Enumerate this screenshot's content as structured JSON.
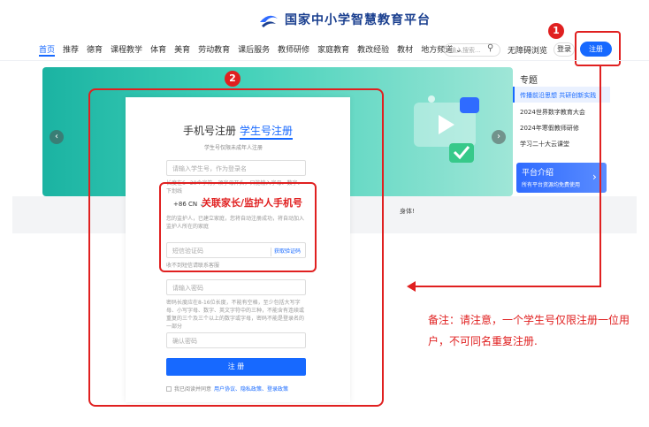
{
  "header": {
    "logo_text": "国家中小学智慧教育平台",
    "nav": [
      "首页",
      "推荐",
      "德育",
      "课程教学",
      "体育",
      "美育",
      "劳动教育",
      "课后服务",
      "教师研修",
      "家庭教育",
      "教改经验",
      "教材",
      "地方频道 ⌄"
    ],
    "search_placeholder": "输入搜索...",
    "accessibility": "无障碍浏览",
    "login": "登录",
    "register": "注册"
  },
  "badges": {
    "one": "1",
    "two": "2"
  },
  "topics": {
    "title": "专题",
    "items": [
      "传播前沿思想 共研创新实践",
      "2024世界数字教育大会",
      "2024年寒假教师研修",
      "学习二十大云课堂"
    ],
    "platform_title": "平台介绍",
    "platform_sub": "所有平台资源均免费使用",
    "platform_arrow": "›"
  },
  "banner": {
    "left_arrow": "‹",
    "right_arrow": "›",
    "band_text": "身体!"
  },
  "modal": {
    "tab_phone": "手机号注册",
    "tab_student": "学生号注册",
    "tab_hint": "学生号仅限未成年人注册",
    "student_id_placeholder": "请输入学生号，作为登录名",
    "student_id_hint": "长度在6~20个字符，须字母开头，只能输入字母、数字、下划线",
    "country_code": "+86 CN ⌄",
    "guardian_label": "关联家长/监护人手机号",
    "guardian_hint": "您的监护人，已建立家庭，您将自动注册成功，将自动加入监护人所在的家庭",
    "code_placeholder": "短信验证码",
    "code_button": "获取验证码",
    "code_help": "收不到短信请联系客服",
    "password_placeholder": "请输入密码",
    "password_hint": "密码长度应在8-16位长度，不能有空格，至少包括大写字母、小写字母、数字、英文字符中的三种，不能含有连续或重复的三个及三个以上的数字或字母，密码不能是登录名的一部分",
    "confirm_placeholder": "确认密码",
    "submit": "注 册",
    "agree_prefix": "我已阅读并同意",
    "agree_links": "用户协议、隐私政策、登录政策"
  },
  "note": "备注：请注意，一个学生号仅限注册一位用户，不可同名重复注册.",
  "colors": {
    "accent": "#1769ff",
    "annotation": "#e02020"
  }
}
